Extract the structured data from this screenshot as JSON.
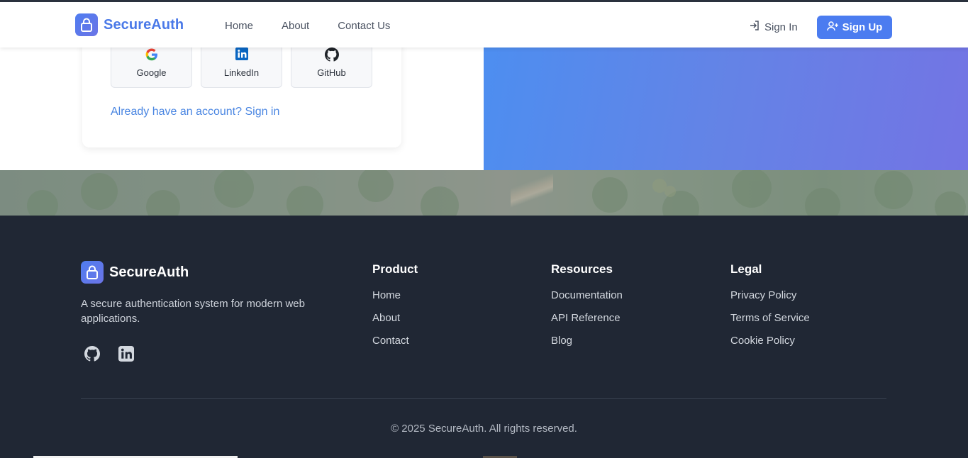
{
  "header": {
    "brand": "SecureAuth",
    "nav": [
      "Home",
      "About",
      "Contact Us"
    ],
    "sign_in": "Sign In",
    "sign_up": "Sign Up"
  },
  "signup_card": {
    "social": [
      {
        "label": "Google",
        "icon": "google-icon"
      },
      {
        "label": "LinkedIn",
        "icon": "linkedin-icon"
      },
      {
        "label": "GitHub",
        "icon": "github-icon"
      }
    ],
    "already_text": "Already have an account? Sign in"
  },
  "footer": {
    "brand": "SecureAuth",
    "description": "A secure authentication system for modern web applications.",
    "social_icons": [
      "github-icon",
      "linkedin-icon"
    ],
    "columns": [
      {
        "title": "Product",
        "links": [
          "Home",
          "About",
          "Contact"
        ]
      },
      {
        "title": "Resources",
        "links": [
          "Documentation",
          "API Reference",
          "Blog"
        ]
      },
      {
        "title": "Legal",
        "links": [
          "Privacy Policy",
          "Terms of Service",
          "Cookie Policy"
        ]
      }
    ],
    "copyright": "© 2025 SecureAuth. All rights reserved."
  },
  "colors": {
    "brand_blue": "#4a79e8",
    "button_blue": "#4b7cf0",
    "footer_bg": "#202734",
    "gradient_start": "#4d8ef0",
    "gradient_end": "#7374e4"
  }
}
